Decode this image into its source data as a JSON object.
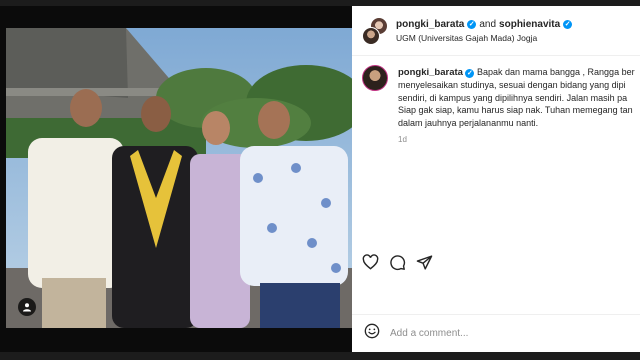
{
  "post": {
    "author": "pongki_barata",
    "connector": "and",
    "coauthor": "sophienavita",
    "location": "UGM (Universitas Gajah Mada) Jogja"
  },
  "caption": {
    "username": "pongki_barata",
    "lines": [
      "Bapak dan mama bangga , Rangga ber",
      "menyelesaikan studinya, sesuai dengan bidang yang dipi",
      "sendiri, di kampus yang dipilihnya sendiri. Jalan masih pa",
      "Siap gak siap, kamu harus siap nak. Tuhan memegang tan",
      "dalam jauhnya perjalananmu nanti."
    ],
    "time": "1d"
  },
  "actions": {
    "like": "heart-icon",
    "comment": "comment-icon",
    "share": "share-icon"
  },
  "comment_box": {
    "emoji": "emoji-icon",
    "placeholder": "Add a comment..."
  },
  "colors": {
    "verified": "#0095f6",
    "text": "#262626",
    "muted": "#8e8e8e",
    "backdrop": "#0b0b0b"
  }
}
